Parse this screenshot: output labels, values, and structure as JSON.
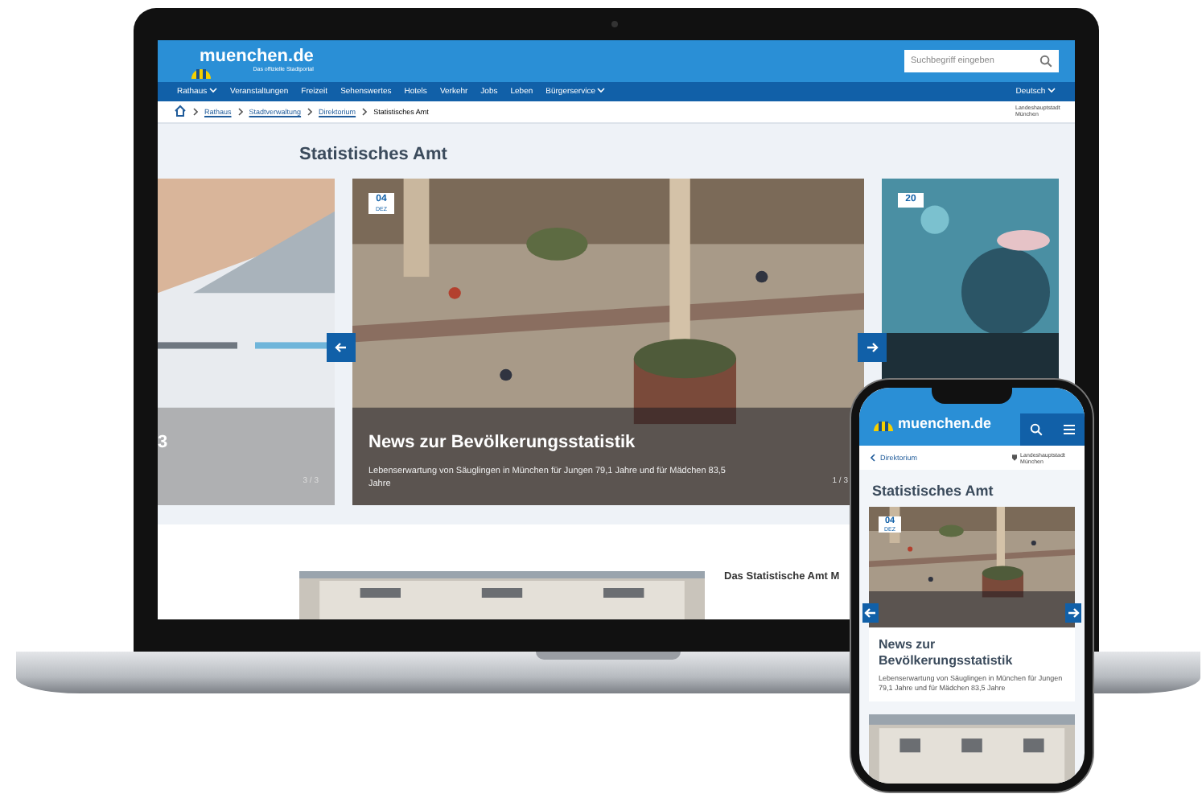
{
  "laptop": {
    "header": {
      "logo": "muenchen.de",
      "tagline": "Das offizielle Stadtportal",
      "search_placeholder": "Suchbegriff eingeben"
    },
    "nav": [
      {
        "label": "Rathaus",
        "has_menu": true
      },
      {
        "label": "Veranstaltungen",
        "has_menu": false
      },
      {
        "label": "Freizeit",
        "has_menu": false
      },
      {
        "label": "Sehenswertes",
        "has_menu": false
      },
      {
        "label": "Hotels",
        "has_menu": false
      },
      {
        "label": "Verkehr",
        "has_menu": false
      },
      {
        "label": "Jobs",
        "has_menu": false
      },
      {
        "label": "Leben",
        "has_menu": false
      },
      {
        "label": "Bürgerservice",
        "has_menu": true
      }
    ],
    "language": "Deutsch",
    "breadcrumb": [
      "Rathaus",
      "Stadtverwaltung",
      "Direktorium",
      "Statistisches Amt"
    ],
    "city_label": "Landeshauptstadt München",
    "heading": "Statistisches Amt",
    "slides": [
      {
        "kind": "side",
        "title": "3",
        "counter": "3 / 3"
      },
      {
        "kind": "main",
        "badge_day": "04",
        "badge_month": "DEZ",
        "title": "News zur Bevölkerungsstatistik",
        "description": "Lebenserwartung von Säuglingen in München für Jungen 79,1 Jahre und für Mädchen 83,5 Jahre",
        "counter": "1 / 3"
      },
      {
        "kind": "side",
        "badge_day": "20"
      }
    ],
    "next_section_title": "Das Statistische Amt M"
  },
  "phone": {
    "logo": "muenchen.de",
    "back_link": "Direktorium",
    "city_label": "Landeshauptstadt München",
    "heading": "Statistisches Amt",
    "slide": {
      "badge_day": "04",
      "badge_month": "DEZ",
      "title": "News zur Bevölkerungsstatistik",
      "description": "Lebenserwartung von Säuglingen in München für Jungen 79,1 Jahre und für Mädchen 83,5 Jahre"
    }
  }
}
